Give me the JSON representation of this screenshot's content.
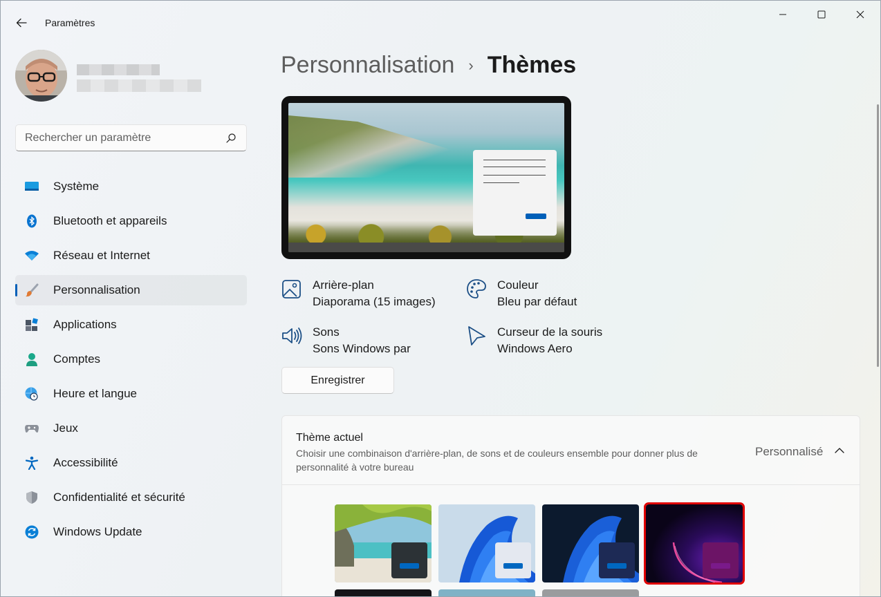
{
  "window": {
    "title": "Paramètres",
    "controls": {
      "minimize": "minimize",
      "maximize": "maximize",
      "close": "close"
    }
  },
  "search": {
    "placeholder": "Rechercher un paramètre"
  },
  "nav": {
    "items": [
      {
        "label": "Système",
        "icon": "system-icon",
        "color": "#0f8fd8"
      },
      {
        "label": "Bluetooth et appareils",
        "icon": "bluetooth-icon",
        "color": "#0067c0"
      },
      {
        "label": "Réseau et Internet",
        "icon": "wifi-icon",
        "color": "#0a7fd6"
      },
      {
        "label": "Personnalisation",
        "icon": "brush-icon",
        "color": "#e07a34",
        "active": true
      },
      {
        "label": "Applications",
        "icon": "apps-icon",
        "color": "#4b5563"
      },
      {
        "label": "Comptes",
        "icon": "account-icon",
        "color": "#1aa88a"
      },
      {
        "label": "Heure et langue",
        "icon": "globe-clock-icon",
        "color": "#1e88d8"
      },
      {
        "label": "Jeux",
        "icon": "gamepad-icon",
        "color": "#6b7280"
      },
      {
        "label": "Accessibilité",
        "icon": "accessibility-icon",
        "color": "#0067c0"
      },
      {
        "label": "Confidentialité et sécurité",
        "icon": "shield-icon",
        "color": "#6b7280"
      },
      {
        "label": "Windows Update",
        "icon": "update-icon",
        "color": "#0a7fd6"
      }
    ]
  },
  "breadcrumb": {
    "parent": "Personnalisation",
    "separator": "›",
    "current": "Thèmes"
  },
  "properties": {
    "background": {
      "title": "Arrière-plan",
      "value": "Diaporama (15 images)"
    },
    "color": {
      "title": "Couleur",
      "value": "Bleu par défaut"
    },
    "sounds": {
      "title": "Sons",
      "value": "Sons Windows par"
    },
    "cursor": {
      "title": "Curseur de la souris",
      "value": "Windows Aero"
    }
  },
  "save_button": "Enregistrer",
  "current_theme": {
    "title": "Thème actuel",
    "description": "Choisir une combinaison d'arrière-plan, de sons et de couleurs ensemble pour donner plus de personnalité à votre bureau",
    "value": "Personnalisé"
  },
  "colors": {
    "accent": "#005fb8",
    "selection": "#e00000"
  }
}
